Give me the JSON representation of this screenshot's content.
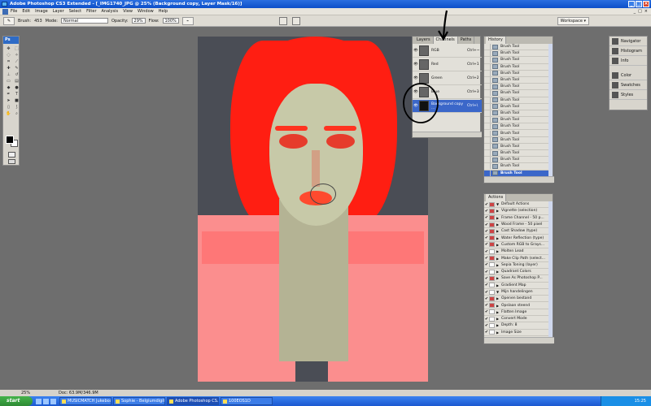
{
  "titlebar": {
    "title": "Adobe Photoshop CS3 Extended - [_IMG1740_JPG @ 25% (Background copy, Layer Mask/16)]",
    "minimize": "_",
    "maximize": "□",
    "close": "×"
  },
  "menu": {
    "items": [
      "File",
      "Edit",
      "Image",
      "Layer",
      "Select",
      "Filter",
      "Analysis",
      "View",
      "Window",
      "Help"
    ],
    "doc_controls": [
      "_",
      "□",
      "×"
    ]
  },
  "options": {
    "brush_label": "Brush:",
    "brush_size": "453",
    "mode_label": "Mode:",
    "mode_value": "Normal",
    "opacity_label": "Opacity:",
    "opacity_value": "29%",
    "flow_label": "Flow:",
    "flow_value": "100%",
    "workspace": "Workspace ▾"
  },
  "toolbox": {
    "header": "Ps",
    "icons": [
      "move-icon",
      "marquee-icon",
      "lasso-icon",
      "magic-wand-icon",
      "crop-icon",
      "slice-icon",
      "healing-icon",
      "brush-icon",
      "stamp-icon",
      "history-brush-icon",
      "eraser-icon",
      "gradient-icon",
      "blur-icon",
      "dodge-icon",
      "pen-icon",
      "type-icon",
      "path-select-icon",
      "shape-icon",
      "notes-icon",
      "eyedropper-icon",
      "hand-icon",
      "zoom-icon"
    ]
  },
  "channels": {
    "tabs": [
      "Layers",
      "Channels",
      "Paths"
    ],
    "active_tab": "Channels",
    "rows": [
      {
        "name": "RGB",
        "key": "Ctrl+~"
      },
      {
        "name": "Red",
        "key": "Ctrl+1"
      },
      {
        "name": "Green",
        "key": "Ctrl+2"
      },
      {
        "name": "Blue",
        "key": "Ctrl+3"
      },
      {
        "name": "Background copy ...",
        "key": "Ctrl+\\",
        "selected": true
      }
    ]
  },
  "history": {
    "tab": "History",
    "items": [
      "Brush Tool",
      "Brush Tool",
      "Brush Tool",
      "Brush Tool",
      "Brush Tool",
      "Brush Tool",
      "Brush Tool",
      "Brush Tool",
      "Brush Tool",
      "Brush Tool",
      "Brush Tool",
      "Brush Tool",
      "Brush Tool",
      "Brush Tool",
      "Brush Tool",
      "Brush Tool",
      "Brush Tool",
      "Brush Tool",
      "Brush Tool",
      "Brush Tool"
    ],
    "selected_index": 19
  },
  "actions": {
    "tab": "Actions",
    "rows": [
      {
        "label": "Default Actions",
        "folder": true,
        "red": true
      },
      {
        "label": "Vignette (selection)",
        "red": true
      },
      {
        "label": "Frame Channel - 50 p...",
        "red": true
      },
      {
        "label": "Wood Frame - 50 pixel",
        "red": true
      },
      {
        "label": "Cast Shadow (type)",
        "red": true
      },
      {
        "label": "Water Reflection (type)",
        "red": true
      },
      {
        "label": "Custom RGB to Grays...",
        "red": true
      },
      {
        "label": "Molten Lead",
        "red": false
      },
      {
        "label": "Make Clip Path (select...",
        "red": true
      },
      {
        "label": "Sepia Toning (layer)",
        "red": false
      },
      {
        "label": "Quadrant Colors",
        "red": false
      },
      {
        "label": "Save As Photoshop P...",
        "red": true
      },
      {
        "label": "Gradient Map",
        "red": false
      },
      {
        "label": "Mijn handelingen",
        "folder": true,
        "red": false
      },
      {
        "label": "Openen bestand",
        "red": true
      },
      {
        "label": "Opslaan steend",
        "red": true
      },
      {
        "label": "Flatten Image",
        "red": false
      },
      {
        "label": "Convert Mode",
        "red": false
      },
      {
        "label": "Depth: 8",
        "red": false
      },
      {
        "label": "Image Size",
        "red": false
      }
    ]
  },
  "dock": {
    "items": [
      "Navigator",
      "Histogram",
      "Info",
      "Color",
      "Swatches",
      "Styles"
    ]
  },
  "status": {
    "zoom": "25%",
    "doc": "Doc: 63.9M/346.9M"
  },
  "taskbar": {
    "start": "start",
    "tasks": [
      "MUSICMATCH Jukebox",
      "Sophie - Belgiumdigita...",
      "Adobe Photoshop CS...",
      "100EOS1D"
    ],
    "active_task_index": 2,
    "clock": "15:25"
  }
}
